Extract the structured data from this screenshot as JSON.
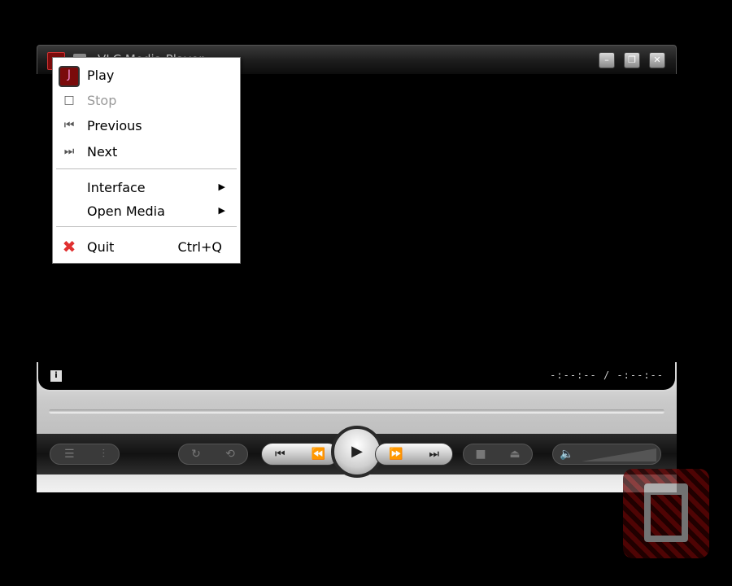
{
  "window": {
    "title": "VLC Media Player"
  },
  "titlebar_buttons": {
    "minimize": "–",
    "restore": "❐",
    "close": "✕"
  },
  "panel": {
    "info_icon": "i",
    "time": "-:--:-- / -:--:--"
  },
  "context_menu": {
    "items": [
      {
        "label": "Play",
        "icon": "vlc-play-icon",
        "enabled": true
      },
      {
        "label": "Stop",
        "icon": "stop-square-icon",
        "enabled": false
      },
      {
        "label": "Previous",
        "icon": "previous-track-icon",
        "enabled": true
      },
      {
        "label": "Next",
        "icon": "next-track-icon",
        "enabled": true
      },
      {
        "label": "Interface",
        "submenu": true
      },
      {
        "label": "Open Media",
        "submenu": true
      },
      {
        "label": "Quit",
        "shortcut": "Ctrl+Q",
        "icon": "quit-x-icon",
        "enabled": true
      }
    ]
  },
  "controls": {
    "playlist": "☰",
    "extended": "⫶",
    "loop": "↻",
    "random": "⟲",
    "prev": "⏮",
    "rewind": "⏪",
    "play": "▶",
    "forward": "⏩",
    "next": "⏭",
    "stop": "■",
    "eject": "⏏",
    "volume": "🔈"
  },
  "colors": {
    "quit_icon": "#e03030",
    "menu_bg": "#ffffff",
    "accent_red": "#7a0b0b"
  }
}
